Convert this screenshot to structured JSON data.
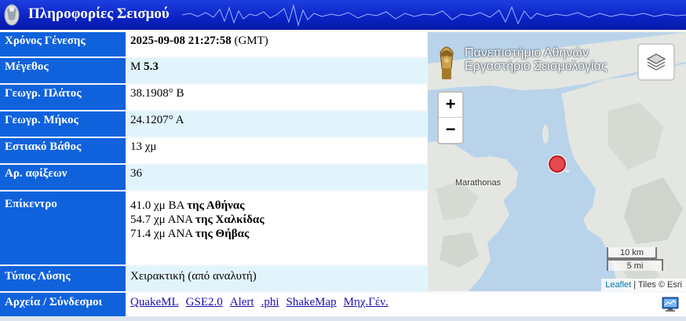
{
  "header": {
    "title": "Πληροφορίες Σεισμού"
  },
  "fields": [
    {
      "label": "Χρόνος Γένεσης",
      "value_bold": "2025-09-08 21:27:58",
      "value_rest": " (GMT)"
    },
    {
      "label": "Μέγεθος",
      "value_prefix": "M ",
      "value_bold": "5.3"
    },
    {
      "label": "Γεωγρ. Πλάτος",
      "value": "38.1908° Β"
    },
    {
      "label": "Γεωγρ. Μήκος",
      "value": "24.1207° Α"
    },
    {
      "label": "Εστιακό Βάθος",
      "value": "13 χμ"
    },
    {
      "label": "Αρ. αφίξεων",
      "value": "36"
    },
    {
      "label": "Επίκεντρο",
      "lines": [
        {
          "text": "41.0 χμ ΒΑ ",
          "bold": "της Αθήνας"
        },
        {
          "text": "54.7 χμ ΑΝΑ ",
          "bold": "της Χαλκίδας"
        },
        {
          "text": "71.4 χμ ΑΝΑ ",
          "bold": "της Θήβας"
        }
      ]
    },
    {
      "label": "Τύπος Λύσης",
      "value": "Χειρακτική (από αναλυτή)"
    },
    {
      "label": "Αρχεία / Σύνδεσμοι",
      "links": [
        "QuakeML",
        "GSE2.0",
        "Alert",
        ".phi",
        "ShakeMap",
        "Μηχ.Γέν."
      ]
    }
  ],
  "map": {
    "brand_line1": "Πανεπιστήμιο Αθηνών",
    "brand_line2": "Εργαστήριο Σεισμολογίας",
    "zoom_in": "+",
    "zoom_out": "−",
    "town": "Marathonas",
    "scale_km": "10 km",
    "scale_mi": "5 mi",
    "attribution_link": "Leaflet",
    "attribution_sep": " | ",
    "attribution_rest": "Tiles © Esri",
    "marker_color": "#e5484d"
  },
  "colors": {
    "header_blue": "#0a22c4",
    "label_blue": "#0f62dc",
    "row_cyan": "#e1f4fb"
  },
  "icons": [
    "seismograph-logo-icon",
    "layers-icon",
    "kml-monitor-icon"
  ]
}
